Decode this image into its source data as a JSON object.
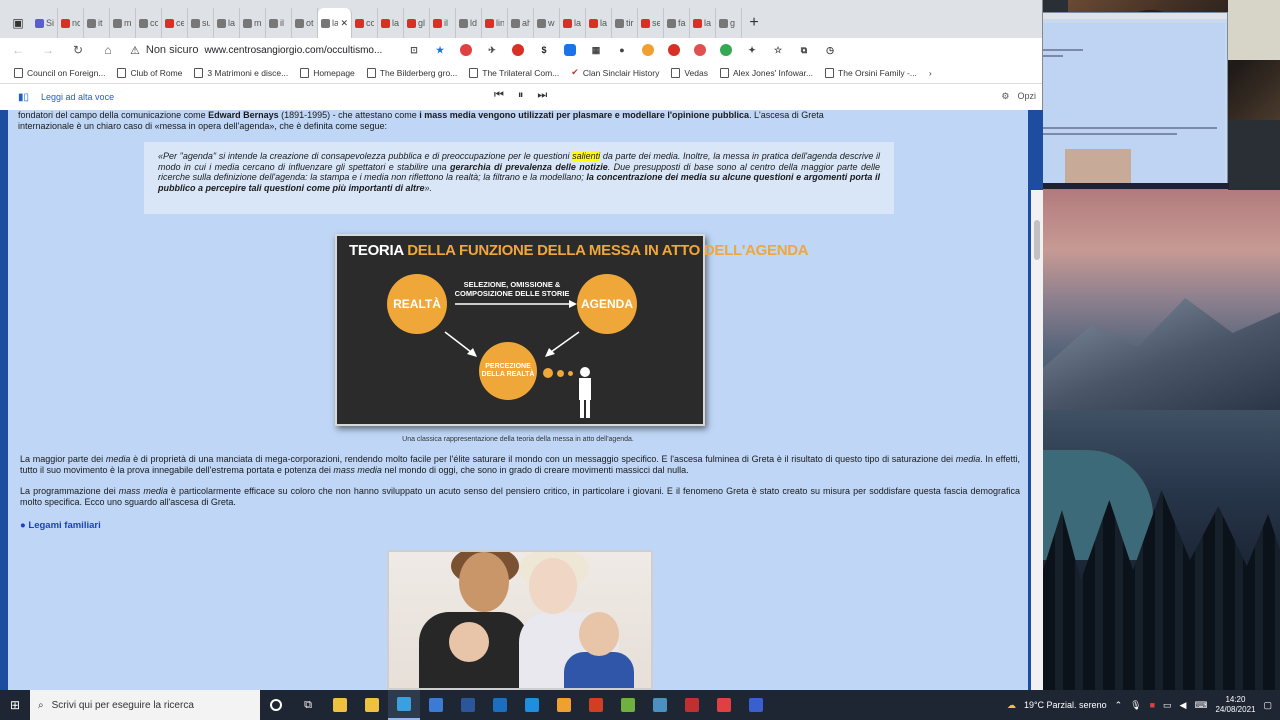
{
  "browser": {
    "tabs": [
      {
        "title": "Si",
        "color": "#5b5bd6"
      },
      {
        "title": "nc",
        "color": "#d93025"
      },
      {
        "title": "it",
        "color": "#777777"
      },
      {
        "title": "m",
        "color": "#777777"
      },
      {
        "title": "co",
        "color": "#777777"
      },
      {
        "title": "ce",
        "color": "#d93025"
      },
      {
        "title": "su",
        "color": "#777777"
      },
      {
        "title": "la",
        "color": "#777777"
      },
      {
        "title": "m",
        "color": "#777777"
      },
      {
        "title": "il",
        "color": "#777777"
      },
      {
        "title": "ot",
        "color": "#777777"
      },
      {
        "title": "la",
        "color": "#777777",
        "active": true
      },
      {
        "title": "co",
        "color": "#d93025"
      },
      {
        "title": "la",
        "color": "#d93025"
      },
      {
        "title": "gl",
        "color": "#d93025"
      },
      {
        "title": "il",
        "color": "#d93025"
      },
      {
        "title": "ld",
        "color": "#777777"
      },
      {
        "title": "lin",
        "color": "#d93025"
      },
      {
        "title": "ah",
        "color": "#777777"
      },
      {
        "title": "w",
        "color": "#777777"
      },
      {
        "title": "la",
        "color": "#d93025"
      },
      {
        "title": "la",
        "color": "#d93025"
      },
      {
        "title": "tir",
        "color": "#777777"
      },
      {
        "title": "se",
        "color": "#d93025"
      },
      {
        "title": "fa",
        "color": "#777777"
      },
      {
        "title": "la",
        "color": "#d93025"
      },
      {
        "title": "g",
        "color": "#777777"
      }
    ],
    "newtab": "+",
    "security_label": "Non sicuro",
    "url": "www.centrosangiorgio.com/occultismo...",
    "bookmarks": [
      "Council on Foreign...",
      "Club of Rome",
      "3 Matrimoni e disce...",
      "Homepage",
      "The Bilderberg gro...",
      "The Trilateral Com...",
      "Clan Sinclair History",
      "Vedas",
      "Alex Jones' Infowar...",
      "The Orsini Family -..."
    ],
    "read_aloud": "Leggi ad alta voce",
    "options": "Opzi"
  },
  "page": {
    "intro_line1_a": "fondatori del campo della comunicazione come ",
    "intro_name": "Edward Bernays",
    "intro_line1_b": " (1891-1995) - che attestano come ",
    "intro_bold": "i mass media vengono utilizzati per plasmare e modellare l'opinione pubblica",
    "intro_line1_c": ". L'ascesa di Greta",
    "intro_line2": "internazionale è un chiaro caso di «messa in opera dell'agenda», che è definita come segue:",
    "quote_a": "«Per \"agenda\" si intende la creazione di consapevolezza pubblica e di preoccupazione per le questioni ",
    "quote_hl": "salienti",
    "quote_b": " da parte dei media. Inoltre, la messa in pratica dell'agenda descrive il modo in cui i media cercano di influenzare gli spettatori e stabilire una ",
    "quote_bold1": "gerarchia di prevalenza delle notizie",
    "quote_c": ". Due presupposti di base sono al centro della maggior parte delle ricerche sulla definizione dell'agenda: la stampa e i media non riflettono la realtà; la filtrano e la modellano; ",
    "quote_bold2": "la concentrazione dei media su alcune questioni e argomenti porta il pubblico a percepire tali questioni come più importanti di altre",
    "quote_d": "».",
    "infographic": {
      "title_white": "TEORIA ",
      "title_orange": "DELLA FUNZIONE DELLA MESSA IN ATTO DELL'AGENDA",
      "left": "REALTÀ",
      "right": "AGENDA",
      "arrow_text": "SELEZIONE, OMISSIONE & COMPOSIZIONE DELLE STORIE",
      "bottom": "PERCEZIONE DELLA REALTÀ"
    },
    "caption": "Una classica rappresentazione della teoria della messa in atto dell'agenda.",
    "p2_a": "La maggior parte dei ",
    "p2_media1": "media",
    "p2_b": " è di proprietà di una manciata di mega-corporazioni, rendendo molto facile per l'élite saturare il mondo con un messaggio specifico. E l'ascesa fulminea di Greta è il risultato di questo tipo di saturazione dei ",
    "p2_media2": "media",
    "p2_c": ". In effetti, tutto il suo movimento è la prova innegabile dell'estrema portata e potenza dei ",
    "p2_mass": "mass media",
    "p2_d": " nel mondo di oggi, che sono in grado di creare movimenti massicci dal nulla.",
    "p3_a": "La programmazione dei ",
    "p3_mass": "mass media",
    "p3_b": " è particolarmente efficace su coloro che non hanno sviluppato un acuto senso del pensiero critico, in particolare i giovani. E il fenomeno Greta è stato creato su misura per soddisfare questa fascia demografica molto specifica. Ecco uno sguardo all'ascesa di Greta.",
    "section_title": "Legami familiari"
  },
  "taskbar": {
    "search_placeholder": "Scrivi qui per eseguire la ricerca",
    "apps": [
      "#f0c040",
      "#f0c040",
      "#3aa0e0",
      "#3a7bd5",
      "#2b579a",
      "#1a6fc0",
      "#1e8fe0",
      "#f0a030",
      "#d04020",
      "#70b040",
      "#4a90c0",
      "#c03030",
      "#e04040",
      "#3a60d0"
    ],
    "weather": "19°C  Parzial. sereno",
    "time": "14:20",
    "date": "24/08/2021"
  }
}
